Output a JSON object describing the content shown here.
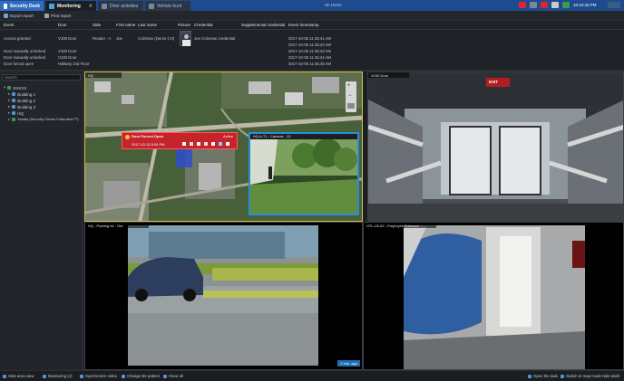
{
  "tabs": [
    {
      "label": "Security Desk"
    },
    {
      "label": "Monitoring"
    },
    {
      "label": "Door activities"
    },
    {
      "label": "Vehicle hunt"
    }
  ],
  "titlebar": {
    "center_text": "Hi! Home",
    "time": "10:44:33 PM"
  },
  "toolbar": {
    "export_label": "Export report",
    "print_label": "Print report"
  },
  "event_table": {
    "columns": [
      "Event",
      "Door",
      "Side",
      "First name",
      "Last name",
      "Picture",
      "Credential",
      "Supplemental credential",
      "Event timestamp"
    ],
    "rows": [
      {
        "event": "Access granted",
        "door": "V100 Door",
        "side": "Reader - A",
        "first": "Joe",
        "last": "Coleman (Demo CH)",
        "credential": "Joe Coleman credential",
        "timestamp": "2017-10-05 11:45:41 AM"
      },
      {
        "event": "",
        "door": "",
        "side": "",
        "first": "",
        "last": "",
        "credential": "",
        "timestamp": "2017-10-05 11:45:42 AM"
      },
      {
        "event": "Door manually unlocked",
        "door": "V100 Door",
        "side": "",
        "first": "",
        "last": "",
        "credential": "",
        "timestamp": "2017-10-05 11:45:43 AM"
      },
      {
        "event": "Door manually unlocked",
        "door": "V100 Door",
        "side": "",
        "first": "",
        "last": "",
        "credential": "",
        "timestamp": "2017-10-05 11:45:44 AM"
      },
      {
        "event": "Door forced open",
        "door": "Hallway 2nd Floor",
        "side": "",
        "first": "",
        "last": "",
        "credential": "",
        "timestamp": "2017-10-05 11:45:45 AM"
      }
    ]
  },
  "left_panel": {
    "search_placeholder": "Search",
    "tree": [
      {
        "label": "SSSVS",
        "level": 0
      },
      {
        "label": "Building 1",
        "level": 1
      },
      {
        "label": "Building 2",
        "level": 1
      },
      {
        "label": "Building 3",
        "level": 1
      },
      {
        "label": "HQ",
        "level": 1
      },
      {
        "label": "Yamby (Security Centre Federation™)",
        "level": 1
      }
    ]
  },
  "tiles": [
    {
      "label": "HQ"
    },
    {
      "label": "V100 Door"
    },
    {
      "label": "HQ - Parking lot - Out"
    },
    {
      "label": "HTL-LB-02 - Employee Entrance"
    }
  ],
  "alarm_popup": {
    "title": "Door Forced Open",
    "state": "Active",
    "date": "2017-10-13 5:00 PM"
  },
  "inset_video": {
    "title": "HQ A-T1 - Camera - 13"
  },
  "tile_badges": {
    "tile3_time": "2 min. ago"
  },
  "statusbar": {
    "hide_area": "Hide area view",
    "monitoring": "Monitoring (4)",
    "synchronize": "Synchronize video",
    "change_pattern": "Change tile pattern",
    "clear_all": "Clear all",
    "open_task": "Open the task",
    "switch_map": "Switch to map mode",
    "hide_dash": "Hide dash"
  },
  "colors": {
    "accent": "#2f6bc0",
    "selection": "#d8c446",
    "alarm": "#d9252b",
    "inset_border": "#2a8dd8"
  }
}
